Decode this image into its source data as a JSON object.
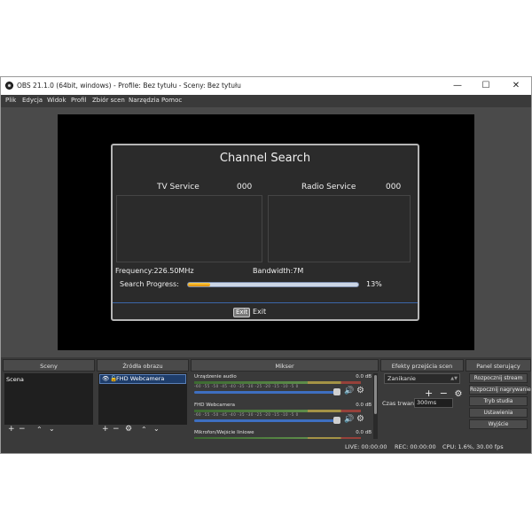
{
  "window": {
    "title": "OBS 21.1.0 (64bit, windows) - Profile: Bez tytułu - Sceny: Bez tytułu",
    "minimize": "—",
    "maximize": "☐",
    "close": "✕"
  },
  "menu": {
    "items": [
      "Plik",
      "Edycja",
      "Widok",
      "Profil",
      "Zbiór scen",
      "Narzędzia",
      "Pomoc"
    ]
  },
  "tv": {
    "title": "Channel Search",
    "tv_service_label": "TV Service",
    "tv_service_count": "000",
    "radio_service_label": "Radio Service",
    "radio_service_count": "000",
    "frequency": "Frequency:226.50MHz",
    "bandwidth": "Bandwidth:7M",
    "progress_label": "Search Progress:",
    "progress_percent": "13%",
    "progress_value": 0.13,
    "exit_key": "Exit",
    "exit_label": "Exit"
  },
  "panels": {
    "scenes": {
      "header": "Sceny",
      "items": [
        "Scena"
      ]
    },
    "sources": {
      "header": "Źródła obrazu",
      "items": [
        "FHD Webcamera"
      ]
    },
    "mixer": {
      "header": "Mikser",
      "ticks": "-60 -55 -50 -45 -40 -35 -30 -25 -20 -15 -10 -5 0",
      "channels": [
        {
          "name": "Urządzenie audio",
          "db": "0.0 dB"
        },
        {
          "name": "FHD Webcamera",
          "db": "0.0 dB"
        },
        {
          "name": "Mikrofon/Wejście liniowe",
          "db": "0.0 dB"
        }
      ]
    },
    "transitions": {
      "header": "Efekty przejścia scen",
      "selected": "Zanikanie",
      "duration_label": "Czas trwania",
      "duration_value": "300ms"
    },
    "controls": {
      "header": "Panel sterujący",
      "buttons": [
        "Rozpocznij stream",
        "Rozpocznij nagrywanie",
        "Tryb studia",
        "Ustawienia",
        "Wyjście"
      ]
    }
  },
  "status": {
    "live": "LIVE: 00:00:00",
    "rec": "REC: 00:00:00",
    "cpu": "CPU: 1.6%, 30.00 fps"
  },
  "colors": {
    "accent": "#3e6fc0",
    "progress": "#f0a500",
    "background": "#3a3a3a"
  }
}
